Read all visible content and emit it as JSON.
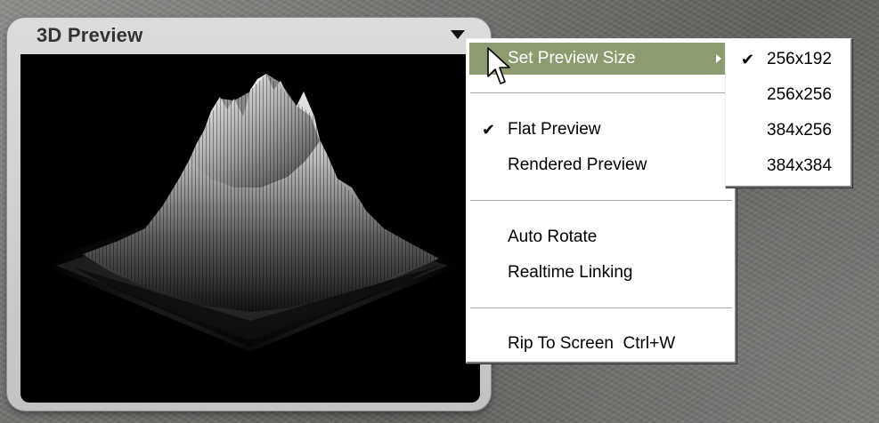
{
  "panel": {
    "title": "3D Preview",
    "menu_icon": "menu-triangle-icon"
  },
  "context_menu": {
    "items": [
      {
        "label": "Set Preview Size",
        "checked": false,
        "highlighted": true,
        "has_submenu": true
      },
      {
        "label": "Flat Preview",
        "checked": true
      },
      {
        "label": "Rendered Preview",
        "checked": false
      },
      {
        "label": "Auto Rotate",
        "checked": false
      },
      {
        "label": "Realtime Linking",
        "checked": false
      },
      {
        "label": "Rip To Screen  Ctrl+W",
        "checked": false
      }
    ],
    "check_glyph": "✔"
  },
  "submenu": {
    "items": [
      {
        "label": "256x192",
        "checked": true
      },
      {
        "label": "256x256",
        "checked": false
      },
      {
        "label": "384x256",
        "checked": false
      },
      {
        "label": "384x384",
        "checked": false
      }
    ]
  },
  "colors": {
    "highlight": "#8d9b70",
    "panel_bg": "#c9c9c9",
    "viewport_bg": "#000000"
  },
  "cursor_icon": "arrow-pointer-icon"
}
